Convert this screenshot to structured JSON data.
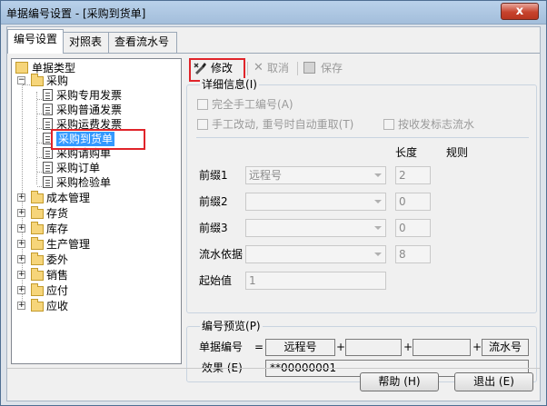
{
  "window": {
    "title": "单据编号设置 - [采购到货单]",
    "close": "x"
  },
  "tabs": [
    "编号设置",
    "对照表",
    "查看流水号"
  ],
  "tree": {
    "root": "单据类型",
    "purchase": "采购",
    "purchase_children": [
      "采购专用发票",
      "采购普通发票",
      "采购运费发票",
      "采购到货单",
      "采购请购单",
      "采购订单",
      "采购检验单"
    ],
    "others": [
      "成本管理",
      "存货",
      "库存",
      "生产管理",
      "委外",
      "销售",
      "应付",
      "应收"
    ]
  },
  "toolbar": {
    "modify": "修改",
    "cancel": "取消",
    "save": "保存"
  },
  "detail": {
    "legend": "详细信息",
    "legend_key": "(I)",
    "manual_all": "完全手工编号",
    "manual_all_key": "(A)",
    "manual_change": "手工改动, 重号时自动重取",
    "manual_change_key": "(T)",
    "by_flag": "按收发标志流水",
    "col_length": "长度",
    "col_rule": "规则",
    "rows": [
      {
        "label": "前缀1",
        "value": "远程号",
        "length": "2"
      },
      {
        "label": "前缀2",
        "value": "",
        "length": "0"
      },
      {
        "label": "前缀3",
        "value": "",
        "length": "0"
      },
      {
        "label": "流水依据",
        "value": "",
        "length": "8"
      }
    ],
    "start_label": "起始值",
    "start_value": "1"
  },
  "preview": {
    "legend": "编号预览",
    "legend_key": "(P)",
    "doc_label": "单据编号",
    "eq": "=",
    "plus": "+",
    "parts": [
      "远程号",
      "",
      "",
      "流水号"
    ],
    "effect_label": "效果",
    "effect_key": "(E)",
    "effect_value": "**00000001"
  },
  "buttons": {
    "help": "帮助 (H)",
    "exit": "退出 (E)"
  }
}
